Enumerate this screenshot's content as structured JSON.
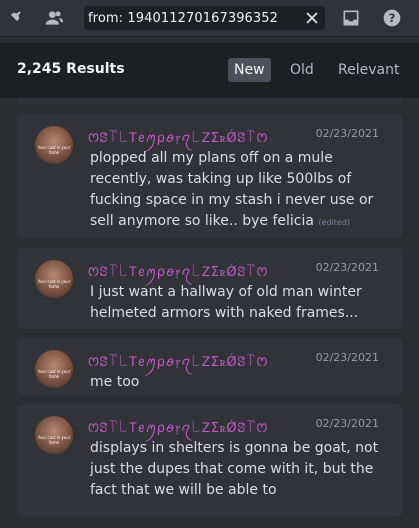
{
  "search": {
    "query": "from: 194011270167396352"
  },
  "results": {
    "count_label": "2,245 Results",
    "sort_tabs": [
      {
        "label": "New"
      },
      {
        "label": "Old"
      },
      {
        "label": "Relevant"
      }
    ]
  },
  "messages": [
    {
      "username": "ꯁꗟ꓅꒒Ꭲꫀꪑρꪮ᥅ꪖ꒒ᏃΣꭱǾꗟ꓅ꯁ",
      "date": "02/23/2021",
      "text": "plopped all my plans off on a mule recently, was taking up like 500lbs of fucking space in my stash i never use or sell anymore so like.. bye felicia",
      "edited": "(edited)",
      "avatar_caption": "Your cost is your fame"
    },
    {
      "username": "ꯁꗟ꓅꒒Ꭲꫀꪑρꪮ᥅ꪖ꒒ᏃΣꭱǾꗟ꓅ꯁ",
      "date": "02/23/2021",
      "text": "I just want a hallway of old man winter helmeted armors with naked frames...",
      "avatar_caption": "Your cost is your fame"
    },
    {
      "username": "ꯁꗟ꓅꒒Ꭲꫀꪑρꪮ᥅ꪖ꒒ᏃΣꭱǾꗟ꓅ꯁ",
      "date": "02/23/2021",
      "text": "me too",
      "avatar_caption": "Your cost is your fame"
    },
    {
      "username": "ꯁꗟ꓅꒒Ꭲꫀꪑρꪮ᥅ꪖ꒒ᏃΣꭱǾꗟ꓅ꯁ",
      "date": "02/23/2021",
      "text": "displays in shelters is gonna be goat, not just the dupes that come with it, but the fact that we will be able to",
      "avatar_caption": "Your cost is your fame"
    }
  ],
  "icons": {
    "pin": "pin-icon",
    "members": "members-icon",
    "clear": "close-icon",
    "inbox": "inbox-icon",
    "help": "help-icon"
  }
}
